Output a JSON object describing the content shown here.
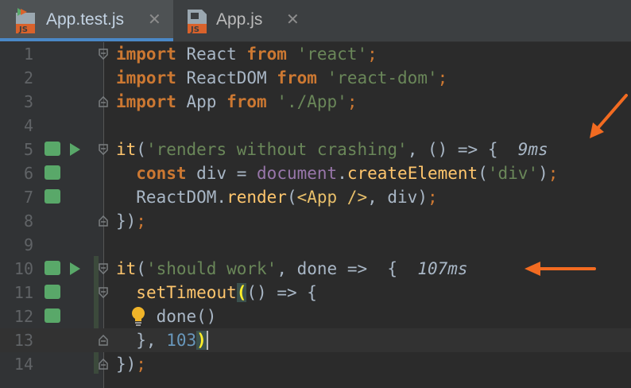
{
  "editor": {
    "tabs": [
      {
        "label": "App.test.js",
        "badge": "JS",
        "active": true,
        "close": "✕"
      },
      {
        "label": "App.js",
        "badge": "JS",
        "active": false,
        "close": "✕"
      }
    ],
    "lines": [
      {
        "num": "1"
      },
      {
        "num": "2"
      },
      {
        "num": "3"
      },
      {
        "num": "4"
      },
      {
        "num": "5"
      },
      {
        "num": "6"
      },
      {
        "num": "7"
      },
      {
        "num": "8"
      },
      {
        "num": "9"
      },
      {
        "num": "10"
      },
      {
        "num": "11"
      },
      {
        "num": "12"
      },
      {
        "num": "13"
      },
      {
        "num": "14"
      }
    ],
    "tokens": {
      "l1": [
        "import",
        " React ",
        "from",
        " ",
        "'react'",
        ";"
      ],
      "l2": [
        "import",
        " ReactDOM ",
        "from",
        " ",
        "'react-dom'",
        ";"
      ],
      "l3": [
        "import",
        " App ",
        "from",
        " ",
        "'./App'",
        ";"
      ],
      "l5": [
        "it",
        "(",
        "'renders without crashing'",
        ", () => {  ",
        "9ms"
      ],
      "l6": [
        "  ",
        "const",
        " div = ",
        "document",
        ".",
        "createElement",
        "(",
        "'div'",
        ")",
        ";"
      ],
      "l7": [
        "  ReactDOM.",
        "render",
        "(",
        "<App />",
        ", div)",
        ";"
      ],
      "l8": [
        "})",
        ";"
      ],
      "l10": [
        "it",
        "(",
        "'should work'",
        ", done =>  {  ",
        "107ms"
      ],
      "l11": [
        "  ",
        "setTimeout",
        "(",
        "() => {"
      ],
      "l12": [
        "    done()"
      ],
      "l13": [
        "  }, ",
        "103",
        ")"
      ],
      "l14": [
        "})",
        ";"
      ]
    },
    "test_durations": [
      "9ms",
      "107ms"
    ],
    "colors": {
      "background": "#2b2b2b",
      "gutter": "#313335",
      "keyword": "#cc7832",
      "string": "#6a8759",
      "function": "#ffc66d",
      "number": "#6897bb",
      "run_marker": "#59a869",
      "annotation_arrow": "#f26b21",
      "active_tab_underline": "#4a88c7"
    },
    "icons": [
      "js-file-icon",
      "test-file-icon",
      "close-icon",
      "fold-icon",
      "run-test-icon",
      "test-passed-icon",
      "lightbulb-icon",
      "arrow-annotation"
    ]
  }
}
